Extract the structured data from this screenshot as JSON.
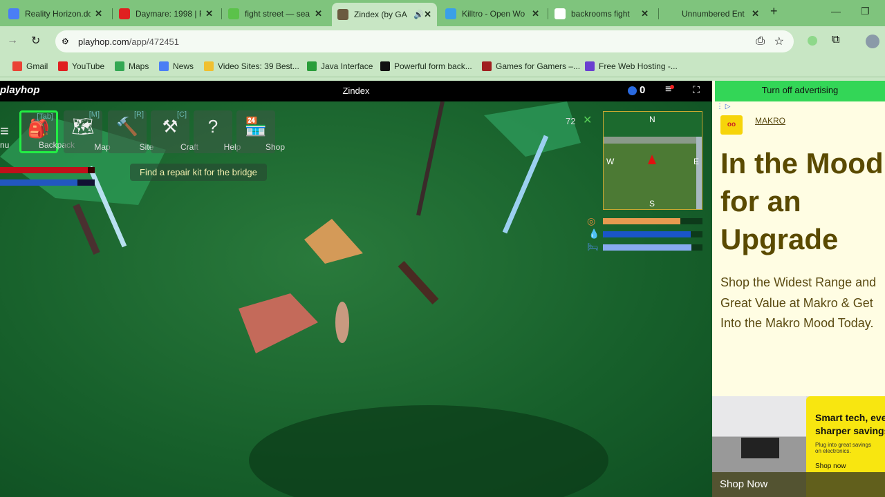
{
  "browser": {
    "tabs": [
      {
        "title": "Reality Horizon.do",
        "icon": "docs-icon",
        "color": "#4a7ef5"
      },
      {
        "title": "Daymare: 1998 | F",
        "icon": "youtube-icon",
        "color": "#e02020"
      },
      {
        "title": "fight street — sea",
        "icon": "frog-icon",
        "color": "#5bc24a"
      },
      {
        "title": "Zindex (by GA",
        "icon": "game-icon",
        "color": "#6b5a40",
        "active": true
      },
      {
        "title": "Killtro - Open Wo",
        "icon": "play-store-icon",
        "color": "#3aa0e8"
      },
      {
        "title": "backrooms fight",
        "icon": "google-icon",
        "color": "#ffffff"
      },
      {
        "title": "Unnumbered Ent",
        "icon": "brain-icon",
        "color": "#7fc47d"
      }
    ],
    "url_host": "playhop.com",
    "url_path": "/app/472451",
    "bookmarks": [
      {
        "label": "Gmail",
        "color": "#ea4335"
      },
      {
        "label": "YouTube",
        "color": "#e02020"
      },
      {
        "label": "Maps",
        "color": "#34a853"
      },
      {
        "label": "News",
        "color": "#4a7ef5"
      },
      {
        "label": "Video Sites: 39 Best...",
        "color": "#f0c030"
      },
      {
        "label": "Java Interface",
        "color": "#2a9d3a"
      },
      {
        "label": "Powerful form back...",
        "color": "#111111"
      },
      {
        "label": "Games for Gamers –...",
        "color": "#a02020"
      },
      {
        "label": "Free Web Hosting -...",
        "color": "#6a3fd0"
      }
    ]
  },
  "game": {
    "logo": "playhop",
    "title": "Zindex",
    "coins": "0",
    "menu_label": "nu",
    "buttons": [
      {
        "label": "Backpack",
        "key": "[Tab]",
        "glyph": "🎒"
      },
      {
        "label": "Map",
        "key": "[M]",
        "glyph": "🗺"
      },
      {
        "label": "Site",
        "key": "[R]",
        "glyph": "🔨"
      },
      {
        "label": "Craft",
        "key": "[C]",
        "glyph": "⚒"
      },
      {
        "label": "Help",
        "key": "",
        "glyph": "?"
      },
      {
        "label": "Shop",
        "key": "",
        "glyph": "🏪"
      }
    ],
    "quest": "Find a repair kit for the bridge",
    "enemy_count": "72",
    "compass": {
      "n": "N",
      "s": "S",
      "w": "W",
      "e": "E"
    },
    "stats": {
      "health": 0.93,
      "stamina": 0.82,
      "hunger": 0.78,
      "thirst": 0.88,
      "sleep": 0.89
    }
  },
  "ad": {
    "turn_off": "Turn off advertising",
    "brand": "MAKRO",
    "headline": "In the Mood for an Upgrade",
    "body": "Shop the Widest Range and Great Value at Makro & Get Into the Makro Mood Today.",
    "banner_title": "Smart tech, even sharper savings",
    "banner_sub": "Plug into great savings on electronics.",
    "banner_cta": "Shop now",
    "shop_now": "Shop Now"
  }
}
